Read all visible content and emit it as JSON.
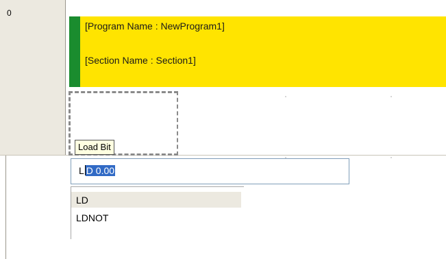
{
  "rung": {
    "number": "0"
  },
  "comment": {
    "program_name": "[Program Name : NewProgram1]",
    "section_name": "[Section Name : Section1]",
    "background_color": "#ffe400",
    "bar_color": "#1a8c2e"
  },
  "tooltip": {
    "text": "Load Bit"
  },
  "instruction_input": {
    "value_prefix": "L",
    "value_selected": "D 0.00",
    "value": "LD 0.00"
  },
  "suggestions": {
    "items": [
      {
        "label": "LD",
        "highlighted": true
      },
      {
        "label": "LDNOT",
        "highlighted": false
      }
    ]
  }
}
